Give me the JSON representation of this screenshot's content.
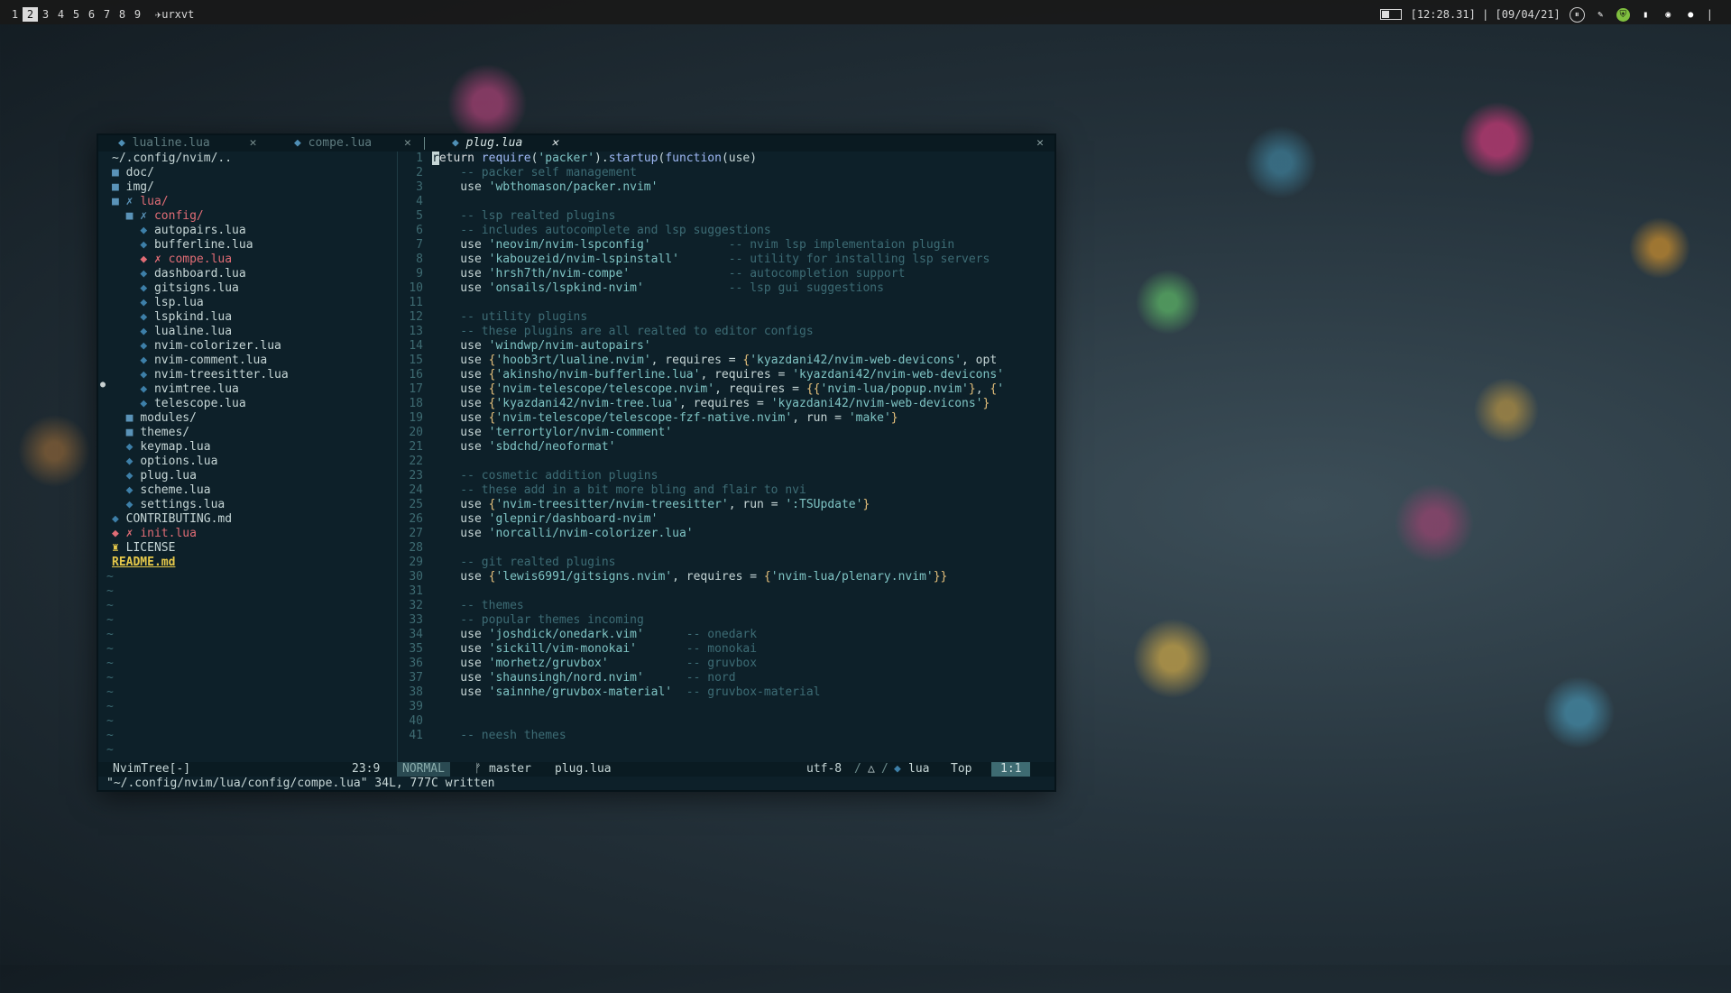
{
  "topbar": {
    "workspaces": [
      "1",
      "2",
      "3",
      "4",
      "5",
      "6",
      "7",
      "8",
      "9"
    ],
    "active_workspace_index": 1,
    "window_title": "✈urxvt",
    "clock": "[12:28.31] | [09/04/21]",
    "separator": "|"
  },
  "tabs": [
    {
      "icon": "lua-icon",
      "label": "lualine.lua",
      "close": "✕"
    },
    {
      "icon": "lua-icon",
      "label": "compe.lua",
      "close": "✕"
    },
    {
      "icon": "lua-icon",
      "label": "plug.lua",
      "close": "✕",
      "active": true
    }
  ],
  "close_all": "✕",
  "tree": {
    "root": "~/.config/nvim/..",
    "items": [
      {
        "prefix": "",
        "icon": "■",
        "label": "doc/",
        "kind": "folder"
      },
      {
        "prefix": "",
        "icon": "■",
        "label": "img/",
        "kind": "folder"
      },
      {
        "prefix": "",
        "icon": "■ ✗",
        "label": "lua/",
        "kind": "modified-folder"
      },
      {
        "prefix": "  ",
        "icon": "■ ✗",
        "label": "config/",
        "kind": "modified-folder"
      },
      {
        "prefix": "    ",
        "icon": "◆",
        "label": "autopairs.lua",
        "kind": "file"
      },
      {
        "prefix": "    ",
        "icon": "◆",
        "label": "bufferline.lua",
        "kind": "file"
      },
      {
        "prefix": "    ",
        "icon": "◆ ✗",
        "label": "compe.lua",
        "kind": "modified-file"
      },
      {
        "prefix": "    ",
        "icon": "◆",
        "label": "dashboard.lua",
        "kind": "file"
      },
      {
        "prefix": "    ",
        "icon": "◆",
        "label": "gitsigns.lua",
        "kind": "file"
      },
      {
        "prefix": "    ",
        "icon": "◆",
        "label": "lsp.lua",
        "kind": "file"
      },
      {
        "prefix": "    ",
        "icon": "◆",
        "label": "lspkind.lua",
        "kind": "file"
      },
      {
        "prefix": "    ",
        "icon": "◆",
        "label": "lualine.lua",
        "kind": "file"
      },
      {
        "prefix": "    ",
        "icon": "◆",
        "label": "nvim-colorizer.lua",
        "kind": "file"
      },
      {
        "prefix": "    ",
        "icon": "◆",
        "label": "nvim-comment.lua",
        "kind": "file"
      },
      {
        "prefix": "    ",
        "icon": "◆",
        "label": "nvim-treesitter.lua",
        "kind": "file"
      },
      {
        "prefix": "    ",
        "icon": "◆",
        "label": "nvimtree.lua",
        "kind": "file"
      },
      {
        "prefix": "    ",
        "icon": "◆",
        "label": "telescope.lua",
        "kind": "file"
      },
      {
        "prefix": "  ",
        "icon": "■",
        "label": "modules/",
        "kind": "folder"
      },
      {
        "prefix": "  ",
        "icon": "■",
        "label": "themes/",
        "kind": "folder"
      },
      {
        "prefix": "  ",
        "icon": "◆",
        "label": "keymap.lua",
        "kind": "file"
      },
      {
        "prefix": "  ",
        "icon": "◆",
        "label": "options.lua",
        "kind": "file"
      },
      {
        "prefix": "  ",
        "icon": "◆",
        "label": "plug.lua",
        "kind": "file"
      },
      {
        "prefix": "  ",
        "icon": "◆",
        "label": "scheme.lua",
        "kind": "file"
      },
      {
        "prefix": "  ",
        "icon": "◆",
        "label": "settings.lua",
        "kind": "file"
      },
      {
        "prefix": "",
        "icon": "◆",
        "label": "CONTRIBUTING.md",
        "kind": "file"
      },
      {
        "prefix": "",
        "icon": "◆ ✗",
        "label": "init.lua",
        "kind": "modified-file"
      },
      {
        "prefix": "",
        "icon": "♜",
        "label": "LICENSE",
        "kind": "license"
      },
      {
        "prefix": "",
        "icon": "",
        "label": "README.md",
        "kind": "readme"
      }
    ],
    "tilde": "~",
    "gutter_sign": "●"
  },
  "code": [
    [
      [
        "cursor",
        "r"
      ],
      [
        "kw",
        "eturn "
      ],
      [
        "fn",
        "require"
      ],
      [
        "pl",
        "("
      ],
      [
        "str",
        "'packer'"
      ],
      [
        "pl",
        ")."
      ],
      [
        "fn",
        "startup"
      ],
      [
        "pl",
        "("
      ],
      [
        "fn",
        "function"
      ],
      [
        "pl",
        "(use)"
      ]
    ],
    [
      [
        "cm",
        "    -- packer self management"
      ]
    ],
    [
      [
        "pl",
        "    use "
      ],
      [
        "str",
        "'wbthomason/packer.nvim'"
      ]
    ],
    [],
    [
      [
        "cm",
        "    -- lsp realted plugins"
      ]
    ],
    [
      [
        "cm",
        "    -- includes autocomplete and lsp suggestions"
      ]
    ],
    [
      [
        "pl",
        "    use "
      ],
      [
        "str",
        "'neovim/nvim-lspconfig'"
      ],
      [
        "cm",
        "           -- nvim lsp implementaion plugin"
      ]
    ],
    [
      [
        "pl",
        "    use "
      ],
      [
        "str",
        "'kabouzeid/nvim-lspinstall'"
      ],
      [
        "cm",
        "       -- utility for installing lsp servers"
      ]
    ],
    [
      [
        "pl",
        "    use "
      ],
      [
        "str",
        "'hrsh7th/nvim-compe'"
      ],
      [
        "cm",
        "              -- autocompletion support"
      ]
    ],
    [
      [
        "pl",
        "    use "
      ],
      [
        "str",
        "'onsails/lspkind-nvim'"
      ],
      [
        "cm",
        "            -- lsp gui suggestions"
      ]
    ],
    [],
    [
      [
        "cm",
        "    -- utility plugins"
      ]
    ],
    [
      [
        "cm",
        "    -- these plugins are all realted to editor configs"
      ]
    ],
    [
      [
        "pl",
        "    use "
      ],
      [
        "str",
        "'windwp/nvim-autopairs'"
      ]
    ],
    [
      [
        "pl",
        "    use "
      ],
      [
        "br",
        "{"
      ],
      [
        "str",
        "'hoob3rt/lualine.nvim'"
      ],
      [
        "pl",
        ", requires = "
      ],
      [
        "br",
        "{"
      ],
      [
        "str",
        "'kyazdani42/nvim-web-devicons'"
      ],
      [
        "pl",
        ", opt"
      ]
    ],
    [
      [
        "pl",
        "    use "
      ],
      [
        "br",
        "{"
      ],
      [
        "str",
        "'akinsho/nvim-bufferline.lua'"
      ],
      [
        "pl",
        ", requires = "
      ],
      [
        "str",
        "'kyazdani42/nvim-web-devicons'"
      ]
    ],
    [
      [
        "pl",
        "    use "
      ],
      [
        "br",
        "{"
      ],
      [
        "str",
        "'nvim-telescope/telescope.nvim'"
      ],
      [
        "pl",
        ", requires = "
      ],
      [
        "br",
        "{{"
      ],
      [
        "str",
        "'nvim-lua/popup.nvim'"
      ],
      [
        "br",
        "}"
      ],
      [
        "pl",
        ", "
      ],
      [
        "br",
        "{"
      ],
      [
        "str",
        "'"
      ]
    ],
    [
      [
        "pl",
        "    use "
      ],
      [
        "br",
        "{"
      ],
      [
        "str",
        "'kyazdani42/nvim-tree.lua'"
      ],
      [
        "pl",
        ", requires = "
      ],
      [
        "str",
        "'kyazdani42/nvim-web-devicons'"
      ],
      [
        "br",
        "}"
      ]
    ],
    [
      [
        "pl",
        "    use "
      ],
      [
        "br",
        "{"
      ],
      [
        "str",
        "'nvim-telescope/telescope-fzf-native.nvim'"
      ],
      [
        "pl",
        ", run = "
      ],
      [
        "str",
        "'make'"
      ],
      [
        "br",
        "}"
      ]
    ],
    [
      [
        "pl",
        "    use "
      ],
      [
        "str",
        "'terrortylor/nvim-comment'"
      ]
    ],
    [
      [
        "pl",
        "    use "
      ],
      [
        "str",
        "'sbdchd/neoformat'"
      ]
    ],
    [],
    [
      [
        "cm",
        "    -- cosmetic addition plugins"
      ]
    ],
    [
      [
        "cm",
        "    -- these add in a bit more bling and flair to nvi"
      ]
    ],
    [
      [
        "pl",
        "    use "
      ],
      [
        "br",
        "{"
      ],
      [
        "str",
        "'nvim-treesitter/nvim-treesitter'"
      ],
      [
        "pl",
        ", run = "
      ],
      [
        "str",
        "':TSUpdate'"
      ],
      [
        "br",
        "}"
      ]
    ],
    [
      [
        "pl",
        "    use "
      ],
      [
        "str",
        "'glepnir/dashboard-nvim'"
      ]
    ],
    [
      [
        "pl",
        "    use "
      ],
      [
        "str",
        "'norcalli/nvim-colorizer.lua'"
      ]
    ],
    [],
    [
      [
        "cm",
        "    -- git realted plugins"
      ]
    ],
    [
      [
        "pl",
        "    use "
      ],
      [
        "br",
        "{"
      ],
      [
        "str",
        "'lewis6991/gitsigns.nvim'"
      ],
      [
        "pl",
        ", requires = "
      ],
      [
        "br",
        "{"
      ],
      [
        "str",
        "'nvim-lua/plenary.nvim'"
      ],
      [
        "br",
        "}}"
      ]
    ],
    [],
    [
      [
        "cm",
        "    -- themes"
      ]
    ],
    [
      [
        "cm",
        "    -- popular themes incoming"
      ]
    ],
    [
      [
        "pl",
        "    use "
      ],
      [
        "str",
        "'joshdick/onedark.vim'"
      ],
      [
        "cm",
        "      -- onedark"
      ]
    ],
    [
      [
        "pl",
        "    use "
      ],
      [
        "str",
        "'sickill/vim-monokai'"
      ],
      [
        "cm",
        "       -- monokai"
      ]
    ],
    [
      [
        "pl",
        "    use "
      ],
      [
        "str",
        "'morhetz/gruvbox'"
      ],
      [
        "cm",
        "           -- gruvbox"
      ]
    ],
    [
      [
        "pl",
        "    use "
      ],
      [
        "str",
        "'shaunsingh/nord.nvim'"
      ],
      [
        "cm",
        "      -- nord"
      ]
    ],
    [
      [
        "pl",
        "    use "
      ],
      [
        "str",
        "'sainnhe/gruvbox-material'"
      ],
      [
        "cm",
        "  -- gruvbox-material"
      ]
    ],
    [],
    [],
    [
      [
        "cm",
        "    -- neesh themes"
      ]
    ]
  ],
  "statusline": {
    "tree_name": "NvimTree[-]",
    "tree_pos": "23:9",
    "mode": "NORMAL",
    "branch_icon": "ᚠ",
    "branch": "master",
    "file": "plug.lua",
    "encoding": "utf-8",
    "sep": "/",
    "os_icon": "△",
    "ft_icon": "◆",
    "filetype": "lua",
    "scroll": "Top",
    "position": "1:1"
  },
  "cmdline": "\"~/.config/nvim/lua/config/compe.lua\" 34L, 777C written",
  "colors": {
    "term_bg": "#0d2029",
    "string": "#7fc4c4",
    "comment": "#3d6c75",
    "function": "#9fb9f5",
    "modified": "#e06c75",
    "readme": "#e5c84a"
  }
}
